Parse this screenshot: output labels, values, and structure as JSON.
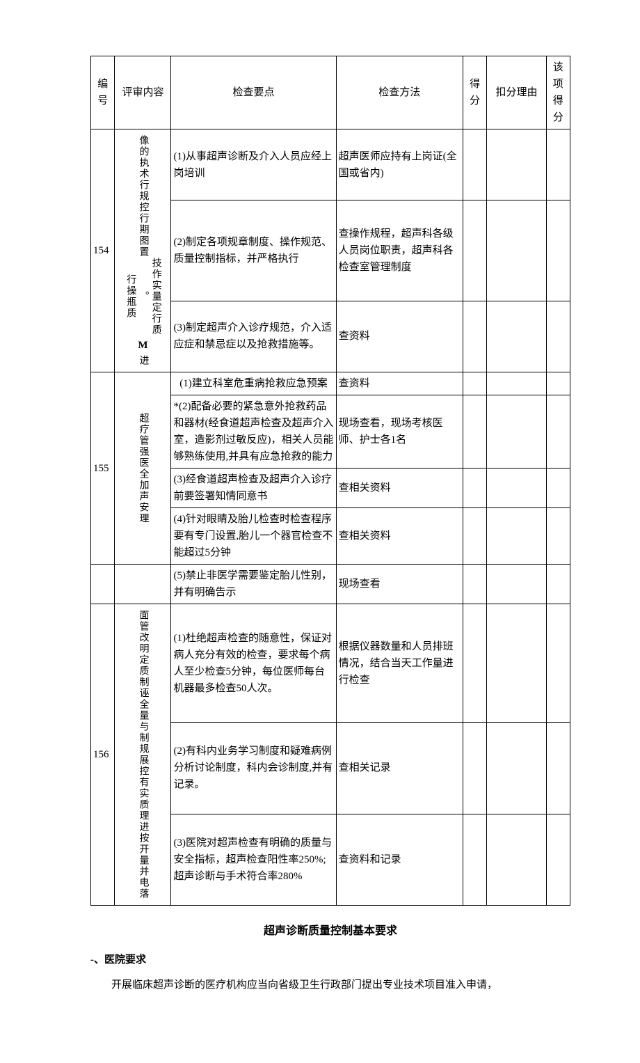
{
  "headers": {
    "id": "编号",
    "content": "评审内容",
    "point": "检查要点",
    "method": "检查方法",
    "score": "得分",
    "reason": "扣分理由",
    "item_score": "该项得分"
  },
  "rows": [
    {
      "id": "154",
      "content": "像的执术行规控行期图置 技作实量定行质。行操瓶质 进",
      "content_icon": "M",
      "points": [
        {
          "text": "(1)从事超声诊断及介入人员应经上岗培训",
          "method": "超声医师应持有上岗证(全国或省内)"
        },
        {
          "text": "(2)制定各项规章制度、操作规范、质量控制指标，并严格执行",
          "method": "查操作规程，超声科各级人员岗位职责，超声科各检查室管理制度"
        },
        {
          "text": "(3)制定超声介入诊疗规范，介入适应症和禁忌症以及抢救措施等。",
          "method": "查资料"
        }
      ]
    },
    {
      "id": "155",
      "content": "超疗管强医全加声安理",
      "points": [
        {
          "text": "(1)建立科室危重病抢救应急预案",
          "method": "查资料",
          "center": true
        },
        {
          "text": "*(2)配备必要的紧急意外抢救药品和器材(经食道超声检查及超声介入室，造影剂过敏反应)，相关人员能够熟练使用,并具有应急抢救的能力",
          "method": "现场查看，现场考核医师、护士各1名"
        },
        {
          "text": "(3)经食道超声检查及超声介入诊疗前要签署知情同意书",
          "method": "查相关资料"
        },
        {
          "text": "(4)针对眼睛及胎儿检查时检查程序要有专门设置,胎儿一个器官检查不能超过5分钟",
          "method": "查相关资料"
        },
        {
          "text": "(5)禁止非医学需要鉴定胎儿性别，并有明确告示",
          "method": "现场查看",
          "detached": true
        }
      ]
    },
    {
      "id": "156",
      "content": "面管改明定质制诬 全量与制规展控有实质理进按开量并电落",
      "points": [
        {
          "text": "(1)杜绝超声检查的随意性，保证对病人充分有效的检查，要求每个病人至少检查5分钟，每位医师每台机器最多检查50人次。",
          "method": "根据仪器数量和人员排班情况，结合当天工作量进行检查",
          "hang": true
        },
        {
          "text": "(2)有科内业务学习制度和疑难病例分析讨论制度，科内会诊制度,并有记录。",
          "method": "查相关记录"
        },
        {
          "text": "(3)医院对超声检查有明确的质量与安全指标，超声检查阳性率250%;超声诊断与手术符合率280%",
          "method": "查资料和记录",
          "hang": true
        }
      ]
    }
  ],
  "heading": "超声诊断质量控制基本要求",
  "section1_title": "-、医院要求",
  "section1_para": "开展临床超声诊断的医疗机构应当向省级卫生行政部门提出专业技术项目准入申请，"
}
